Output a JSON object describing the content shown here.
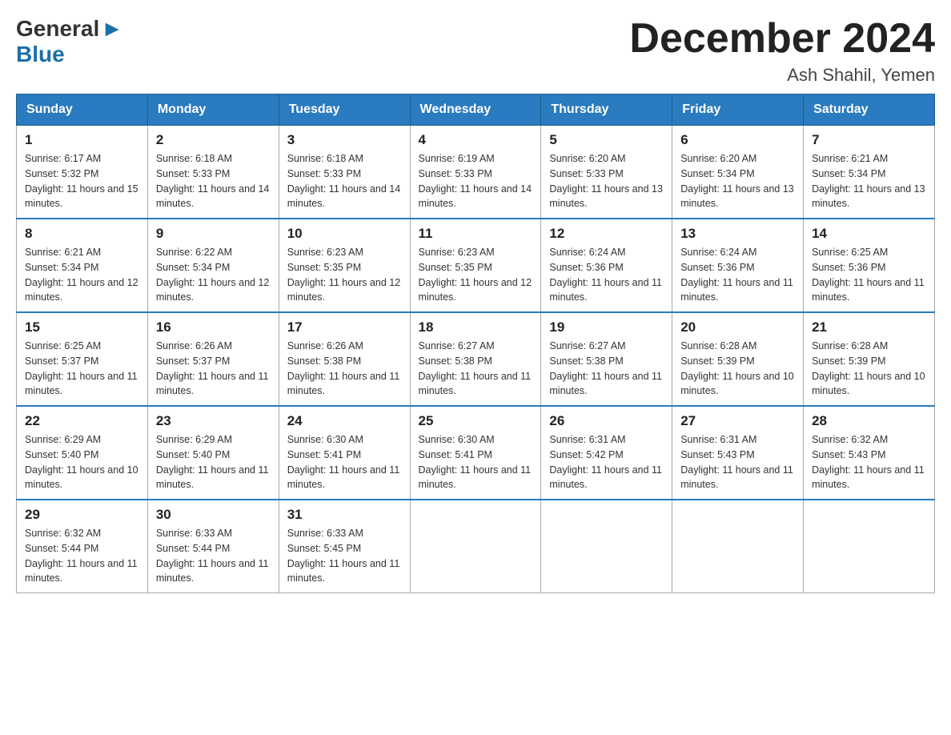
{
  "header": {
    "logo_general": "General",
    "logo_blue": "Blue",
    "month_title": "December 2024",
    "location": "Ash Shahil, Yemen"
  },
  "columns": [
    "Sunday",
    "Monday",
    "Tuesday",
    "Wednesday",
    "Thursday",
    "Friday",
    "Saturday"
  ],
  "weeks": [
    [
      {
        "day": "1",
        "sunrise": "Sunrise: 6:17 AM",
        "sunset": "Sunset: 5:32 PM",
        "daylight": "Daylight: 11 hours and 15 minutes."
      },
      {
        "day": "2",
        "sunrise": "Sunrise: 6:18 AM",
        "sunset": "Sunset: 5:33 PM",
        "daylight": "Daylight: 11 hours and 14 minutes."
      },
      {
        "day": "3",
        "sunrise": "Sunrise: 6:18 AM",
        "sunset": "Sunset: 5:33 PM",
        "daylight": "Daylight: 11 hours and 14 minutes."
      },
      {
        "day": "4",
        "sunrise": "Sunrise: 6:19 AM",
        "sunset": "Sunset: 5:33 PM",
        "daylight": "Daylight: 11 hours and 14 minutes."
      },
      {
        "day": "5",
        "sunrise": "Sunrise: 6:20 AM",
        "sunset": "Sunset: 5:33 PM",
        "daylight": "Daylight: 11 hours and 13 minutes."
      },
      {
        "day": "6",
        "sunrise": "Sunrise: 6:20 AM",
        "sunset": "Sunset: 5:34 PM",
        "daylight": "Daylight: 11 hours and 13 minutes."
      },
      {
        "day": "7",
        "sunrise": "Sunrise: 6:21 AM",
        "sunset": "Sunset: 5:34 PM",
        "daylight": "Daylight: 11 hours and 13 minutes."
      }
    ],
    [
      {
        "day": "8",
        "sunrise": "Sunrise: 6:21 AM",
        "sunset": "Sunset: 5:34 PM",
        "daylight": "Daylight: 11 hours and 12 minutes."
      },
      {
        "day": "9",
        "sunrise": "Sunrise: 6:22 AM",
        "sunset": "Sunset: 5:34 PM",
        "daylight": "Daylight: 11 hours and 12 minutes."
      },
      {
        "day": "10",
        "sunrise": "Sunrise: 6:23 AM",
        "sunset": "Sunset: 5:35 PM",
        "daylight": "Daylight: 11 hours and 12 minutes."
      },
      {
        "day": "11",
        "sunrise": "Sunrise: 6:23 AM",
        "sunset": "Sunset: 5:35 PM",
        "daylight": "Daylight: 11 hours and 12 minutes."
      },
      {
        "day": "12",
        "sunrise": "Sunrise: 6:24 AM",
        "sunset": "Sunset: 5:36 PM",
        "daylight": "Daylight: 11 hours and 11 minutes."
      },
      {
        "day": "13",
        "sunrise": "Sunrise: 6:24 AM",
        "sunset": "Sunset: 5:36 PM",
        "daylight": "Daylight: 11 hours and 11 minutes."
      },
      {
        "day": "14",
        "sunrise": "Sunrise: 6:25 AM",
        "sunset": "Sunset: 5:36 PM",
        "daylight": "Daylight: 11 hours and 11 minutes."
      }
    ],
    [
      {
        "day": "15",
        "sunrise": "Sunrise: 6:25 AM",
        "sunset": "Sunset: 5:37 PM",
        "daylight": "Daylight: 11 hours and 11 minutes."
      },
      {
        "day": "16",
        "sunrise": "Sunrise: 6:26 AM",
        "sunset": "Sunset: 5:37 PM",
        "daylight": "Daylight: 11 hours and 11 minutes."
      },
      {
        "day": "17",
        "sunrise": "Sunrise: 6:26 AM",
        "sunset": "Sunset: 5:38 PM",
        "daylight": "Daylight: 11 hours and 11 minutes."
      },
      {
        "day": "18",
        "sunrise": "Sunrise: 6:27 AM",
        "sunset": "Sunset: 5:38 PM",
        "daylight": "Daylight: 11 hours and 11 minutes."
      },
      {
        "day": "19",
        "sunrise": "Sunrise: 6:27 AM",
        "sunset": "Sunset: 5:38 PM",
        "daylight": "Daylight: 11 hours and 11 minutes."
      },
      {
        "day": "20",
        "sunrise": "Sunrise: 6:28 AM",
        "sunset": "Sunset: 5:39 PM",
        "daylight": "Daylight: 11 hours and 10 minutes."
      },
      {
        "day": "21",
        "sunrise": "Sunrise: 6:28 AM",
        "sunset": "Sunset: 5:39 PM",
        "daylight": "Daylight: 11 hours and 10 minutes."
      }
    ],
    [
      {
        "day": "22",
        "sunrise": "Sunrise: 6:29 AM",
        "sunset": "Sunset: 5:40 PM",
        "daylight": "Daylight: 11 hours and 10 minutes."
      },
      {
        "day": "23",
        "sunrise": "Sunrise: 6:29 AM",
        "sunset": "Sunset: 5:40 PM",
        "daylight": "Daylight: 11 hours and 11 minutes."
      },
      {
        "day": "24",
        "sunrise": "Sunrise: 6:30 AM",
        "sunset": "Sunset: 5:41 PM",
        "daylight": "Daylight: 11 hours and 11 minutes."
      },
      {
        "day": "25",
        "sunrise": "Sunrise: 6:30 AM",
        "sunset": "Sunset: 5:41 PM",
        "daylight": "Daylight: 11 hours and 11 minutes."
      },
      {
        "day": "26",
        "sunrise": "Sunrise: 6:31 AM",
        "sunset": "Sunset: 5:42 PM",
        "daylight": "Daylight: 11 hours and 11 minutes."
      },
      {
        "day": "27",
        "sunrise": "Sunrise: 6:31 AM",
        "sunset": "Sunset: 5:43 PM",
        "daylight": "Daylight: 11 hours and 11 minutes."
      },
      {
        "day": "28",
        "sunrise": "Sunrise: 6:32 AM",
        "sunset": "Sunset: 5:43 PM",
        "daylight": "Daylight: 11 hours and 11 minutes."
      }
    ],
    [
      {
        "day": "29",
        "sunrise": "Sunrise: 6:32 AM",
        "sunset": "Sunset: 5:44 PM",
        "daylight": "Daylight: 11 hours and 11 minutes."
      },
      {
        "day": "30",
        "sunrise": "Sunrise: 6:33 AM",
        "sunset": "Sunset: 5:44 PM",
        "daylight": "Daylight: 11 hours and 11 minutes."
      },
      {
        "day": "31",
        "sunrise": "Sunrise: 6:33 AM",
        "sunset": "Sunset: 5:45 PM",
        "daylight": "Daylight: 11 hours and 11 minutes."
      },
      null,
      null,
      null,
      null
    ]
  ]
}
